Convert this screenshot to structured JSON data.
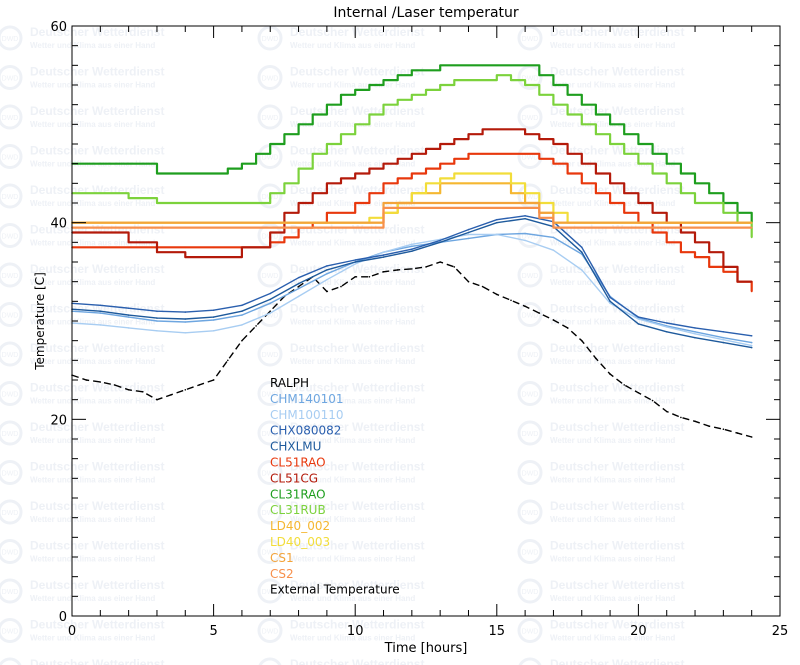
{
  "chart_data": {
    "type": "line",
    "title": "Internal /Laser temperatur",
    "xlabel": "Time [hours]",
    "ylabel": "Temperature [C]",
    "xlim": [
      0,
      25
    ],
    "ylim": [
      0,
      60
    ],
    "xticks": [
      "0",
      "5",
      "10",
      "15",
      "20",
      "25"
    ],
    "yticks": [
      "0",
      "20",
      "40",
      "60"
    ],
    "grid": false,
    "legend_position": "center-left",
    "watermark": {
      "name": "Deutscher Wetterdienst",
      "tagline": "Wetter und Klima aus einer Hand",
      "logo": "DWD"
    },
    "series": [
      {
        "name": "RALPH",
        "color": "#000000",
        "dash": true,
        "x": [
          0,
          0.5,
          1,
          1.5,
          2,
          2.5,
          3,
          3.5,
          4,
          4.5,
          5,
          5.5,
          6,
          6.5,
          7,
          7.5,
          8,
          8.5,
          9,
          9.5,
          10,
          10.5,
          11,
          11.5,
          12,
          12.5,
          13,
          13.5,
          14,
          14.5,
          15,
          15.5,
          16,
          16.5,
          17,
          17.5,
          18,
          18.5,
          19,
          19.5,
          20,
          20.5,
          21,
          21.5,
          22,
          22.5,
          23,
          23.5,
          24
        ],
        "y": [
          24.5,
          24,
          23.8,
          23.5,
          23,
          22.8,
          22,
          22.5,
          23,
          23.5,
          24,
          26,
          28,
          29.5,
          31,
          32.5,
          33.5,
          34.5,
          33,
          33.5,
          34.5,
          34.5,
          35,
          35.2,
          35.3,
          35.5,
          36,
          35.5,
          34,
          33.5,
          32.7,
          32.1,
          31.5,
          30.8,
          30.1,
          29.3,
          28,
          26.2,
          24.6,
          23.5,
          22.7,
          21.9,
          20.8,
          20.2,
          19.8,
          19.3,
          19,
          18.6,
          18.2
        ]
      },
      {
        "name": "CHM140101",
        "color": "#6ea6e0",
        "x": [
          0,
          1,
          2,
          3,
          4,
          5,
          6,
          7,
          8,
          9,
          10,
          11,
          12,
          13,
          14,
          15,
          16,
          17,
          18,
          19,
          20,
          21,
          22,
          23,
          24
        ],
        "y": [
          31,
          30.8,
          30.4,
          30,
          29.9,
          30.1,
          30.6,
          31.8,
          33.3,
          34.8,
          36,
          37,
          37.6,
          38,
          38.4,
          38.8,
          38.9,
          38.5,
          36.8,
          32.5,
          30.3,
          29.5,
          28.9,
          28.3,
          27.8
        ]
      },
      {
        "name": "CHM100110",
        "color": "#a8cdf2",
        "x": [
          0,
          1,
          2,
          3,
          4,
          5,
          6,
          7,
          8,
          9,
          10,
          11,
          12,
          13,
          14,
          15,
          16,
          17,
          18,
          19,
          20,
          21,
          22,
          23,
          24
        ],
        "y": [
          29.8,
          29.6,
          29.3,
          29,
          28.8,
          29,
          29.6,
          30.8,
          32.5,
          34.2,
          35.8,
          37,
          37.8,
          38.3,
          38.8,
          38.8,
          38.2,
          37.2,
          35.2,
          31.8,
          30.2,
          29.4,
          28.7,
          28.1,
          27.5
        ]
      },
      {
        "name": "CHX080082",
        "color": "#2a5fae",
        "x": [
          0,
          1,
          2,
          3,
          4,
          5,
          6,
          7,
          8,
          9,
          10,
          11,
          12,
          13,
          14,
          15,
          16,
          17,
          18,
          19,
          20,
          21,
          22,
          23,
          24
        ],
        "y": [
          31.8,
          31.6,
          31.3,
          31,
          30.9,
          31.1,
          31.6,
          32.8,
          34.4,
          35.6,
          36.2,
          36.7,
          37.3,
          38.2,
          39.3,
          40.3,
          40.7,
          40.1,
          37.5,
          32.4,
          30.4,
          29.8,
          29.3,
          28.9,
          28.5
        ]
      },
      {
        "name": "CHXLMU",
        "color": "#1e5a9c",
        "x": [
          0,
          1,
          2,
          3,
          4,
          5,
          6,
          7,
          8,
          9,
          10,
          11,
          12,
          13,
          14,
          15,
          16,
          17,
          18,
          19,
          20,
          21,
          22,
          23,
          24
        ],
        "y": [
          31.2,
          31,
          30.6,
          30.3,
          30.2,
          30.4,
          31,
          32.2,
          33.8,
          35.2,
          36,
          36.5,
          37.1,
          38,
          39,
          40,
          40.4,
          39.6,
          37,
          32,
          29.7,
          28.9,
          28.3,
          27.8,
          27.3
        ]
      },
      {
        "name": "CL51RAO",
        "color": "#e8380d",
        "step": true,
        "x": [
          0,
          1,
          2,
          3,
          4,
          5,
          6,
          7,
          7.5,
          8,
          8.5,
          9,
          10,
          10.5,
          11,
          11.5,
          12,
          12.5,
          13,
          13.5,
          14,
          14.5,
          15,
          15.5,
          16,
          16.5,
          17,
          17.5,
          18,
          18.5,
          19,
          19.5,
          20,
          20.5,
          21,
          21.5,
          22,
          22.5,
          23,
          23.5,
          24
        ],
        "y": [
          37.5,
          37.5,
          37.5,
          37.5,
          37.5,
          37.5,
          37.5,
          38,
          38.5,
          39.5,
          40,
          41,
          42,
          43,
          44,
          44.5,
          45,
          45.5,
          46,
          46.5,
          47,
          47,
          47,
          47,
          47,
          46.5,
          46,
          45,
          44,
          43,
          42,
          41,
          40,
          39,
          38,
          37,
          36.5,
          35.5,
          35,
          34,
          33
        ]
      },
      {
        "name": "CL51CG",
        "color": "#b41a0a",
        "step": true,
        "x": [
          0,
          1,
          2,
          3,
          4,
          5,
          6,
          7,
          7.5,
          8,
          8.5,
          9,
          9.5,
          10,
          10.5,
          11,
          11.5,
          12,
          12.5,
          13,
          13.5,
          14,
          14.5,
          15,
          15.5,
          16,
          16.5,
          17,
          17.5,
          18,
          18.5,
          19,
          19.5,
          20,
          20.5,
          21,
          21.5,
          22,
          22.5,
          23,
          23.5,
          24
        ],
        "y": [
          39,
          39,
          38,
          37,
          36.5,
          36.5,
          37.5,
          39,
          41,
          42,
          43,
          44,
          44.5,
          45,
          45.5,
          46,
          46.5,
          47,
          47.5,
          48,
          48.5,
          49,
          49.5,
          49.5,
          49.5,
          49,
          48.5,
          48,
          47,
          46,
          45,
          44,
          43,
          42,
          41,
          40,
          39,
          38,
          37,
          35.5,
          34,
          34
        ]
      },
      {
        "name": "CL31RAO",
        "color": "#1e9e1e",
        "step": true,
        "x": [
          0,
          1,
          2,
          3,
          4,
          5,
          5.5,
          6,
          6.5,
          7,
          7.5,
          8,
          8.5,
          9,
          9.5,
          10,
          10.5,
          11,
          11.5,
          12,
          12.5,
          13,
          13.5,
          14,
          14.5,
          15,
          15.5,
          16,
          16.5,
          17,
          17.5,
          18,
          18.5,
          19,
          19.5,
          20,
          20.5,
          21,
          21.5,
          22,
          22.5,
          23,
          23.5,
          24
        ],
        "y": [
          46,
          46,
          46,
          45,
          45,
          45,
          45.5,
          46,
          47,
          48,
          49,
          50,
          51,
          52,
          53,
          53.5,
          54,
          54.5,
          55,
          55.5,
          55.5,
          56,
          56,
          56,
          56,
          56,
          56,
          56,
          55,
          54,
          53,
          52,
          51,
          50,
          49,
          48,
          47,
          46,
          45,
          44,
          43,
          42,
          41,
          40
        ]
      },
      {
        "name": "CL31RUB",
        "color": "#7cd23c",
        "step": true,
        "x": [
          0,
          1,
          2,
          3,
          4,
          5,
          6,
          7,
          7.5,
          8,
          8.5,
          9,
          9.5,
          10,
          10.5,
          11,
          11.5,
          12,
          12.5,
          13,
          13.5,
          14,
          14.5,
          15,
          15.5,
          16,
          16.5,
          17,
          17.5,
          18,
          18.5,
          19,
          19.5,
          20,
          20.5,
          21,
          21.5,
          22,
          22.5,
          23,
          23.5,
          24
        ],
        "y": [
          43,
          43,
          42.5,
          42,
          42,
          42,
          42,
          43,
          44,
          45.5,
          47,
          48,
          49,
          50,
          51,
          52,
          52.5,
          53,
          53.5,
          54,
          54.5,
          54.5,
          54.5,
          55,
          54.5,
          54,
          53,
          52,
          51,
          50,
          49,
          48,
          47,
          46,
          45,
          44,
          43,
          42,
          42,
          41,
          40,
          38.5
        ]
      },
      {
        "name": "LD40_002",
        "color": "#f5b731",
        "step": true,
        "x": [
          0,
          2,
          4,
          6,
          8,
          10,
          10.5,
          11,
          11.5,
          12,
          12.5,
          13,
          13.5,
          14,
          14.5,
          15,
          15.5,
          16,
          16.5,
          17,
          17.5,
          18,
          20,
          22,
          24
        ],
        "y": [
          40,
          40,
          40,
          40,
          40,
          40,
          40,
          41,
          42,
          43,
          43,
          44,
          44,
          44,
          44,
          44,
          43,
          42,
          41,
          40,
          40,
          40,
          40,
          40,
          40
        ]
      },
      {
        "name": "LD40_003",
        "color": "#f2dd3a",
        "step": true,
        "x": [
          0,
          2,
          4,
          6,
          8,
          10,
          10.5,
          11,
          11.5,
          12,
          12.5,
          13,
          13.5,
          14,
          14.5,
          15,
          15.5,
          16,
          16.5,
          17,
          17.5,
          18,
          20,
          22,
          24
        ],
        "y": [
          40,
          40,
          40,
          40,
          40,
          40,
          40.5,
          41,
          42,
          43,
          44,
          44.5,
          45,
          45,
          45,
          45,
          44,
          43,
          42,
          41,
          40,
          40,
          40,
          40,
          40
        ]
      },
      {
        "name": "CS1",
        "color": "#f3a43b",
        "step": true,
        "x": [
          0,
          2,
          4,
          6,
          8,
          10,
          10.5,
          11,
          12,
          13,
          14,
          15,
          16,
          16.5,
          17,
          18,
          20,
          22,
          24
        ],
        "y": [
          40,
          40,
          40,
          40,
          40,
          40,
          40,
          42,
          42,
          42,
          42,
          42,
          42,
          41,
          40,
          40,
          40,
          40,
          40
        ]
      },
      {
        "name": "CS2",
        "color": "#f7904c",
        "step": true,
        "x": [
          0,
          2,
          4,
          6,
          8,
          10,
          10.5,
          11,
          12,
          13,
          14,
          15,
          16,
          16.5,
          17,
          18,
          20,
          22,
          24
        ],
        "y": [
          39.5,
          39.5,
          39.5,
          39.5,
          39.5,
          39.5,
          39.5,
          41.5,
          41.5,
          41.5,
          41.5,
          41.5,
          41.5,
          40.5,
          39.5,
          39.5,
          39.5,
          39.5,
          39.5
        ]
      },
      {
        "name": "External Temperature",
        "color": "#000000",
        "legend_only": true
      }
    ]
  }
}
